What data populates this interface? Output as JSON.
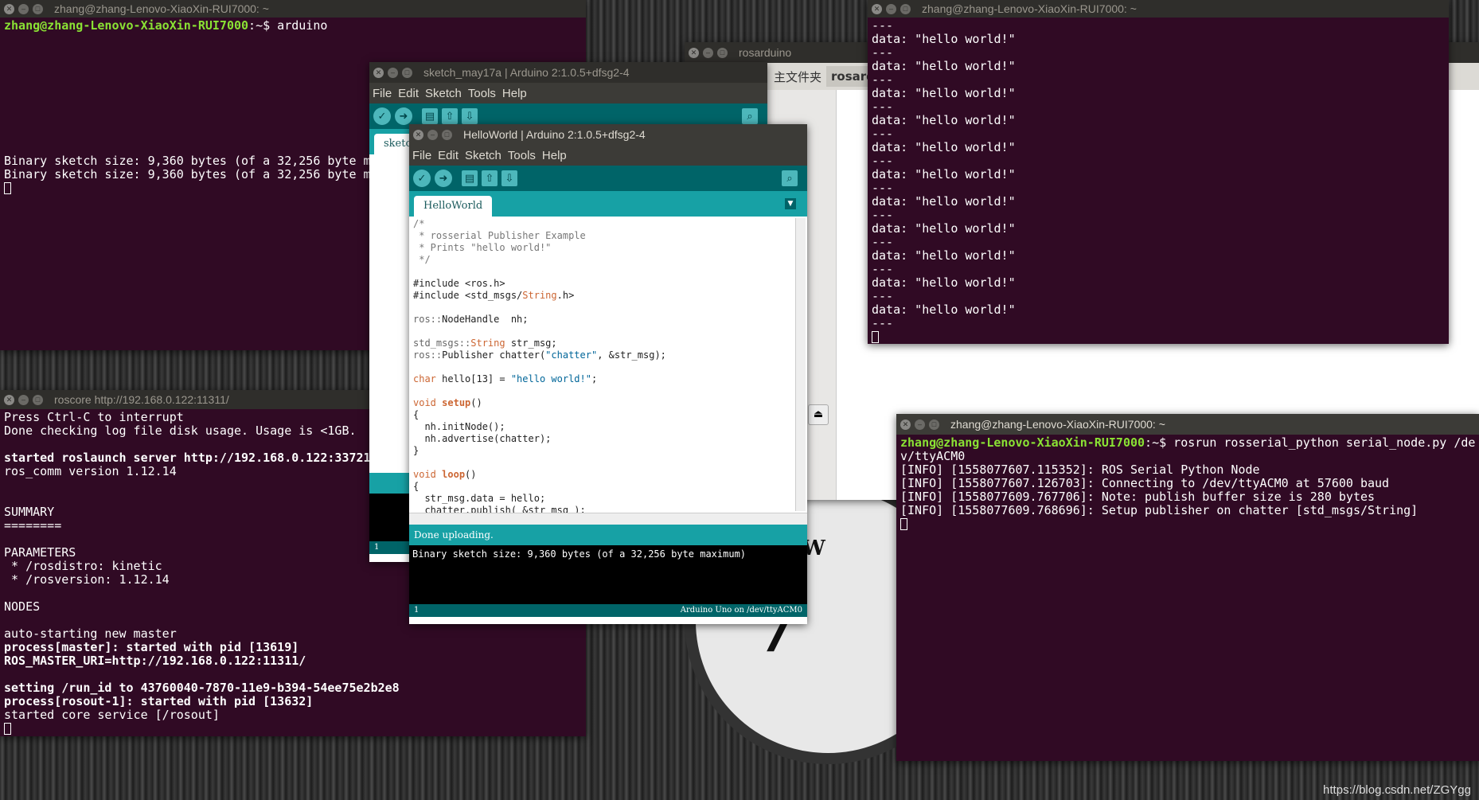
{
  "term_arduino": {
    "title": "zhang@zhang-Lenovo-XiaoXin-RUI7000: ~",
    "prompt_user": "zhang@zhang-Lenovo-XiaoXin-RUI7000",
    "prompt_path": ":~$ ",
    "command": "arduino",
    "line1": "Binary sketch size: 9,360 bytes (of a 32,256 byte m",
    "line2": "Binary sketch size: 9,360 bytes (of a 32,256 byte m"
  },
  "term_roscore": {
    "title": "roscore http://192.168.0.122:11311/",
    "lines": [
      {
        "t": "Press Ctrl-C to interrupt",
        "b": false
      },
      {
        "t": "Done checking log file disk usage. Usage is <1GB.",
        "b": false
      },
      {
        "t": "",
        "b": false
      },
      {
        "t": "started roslaunch server http://192.168.0.122:33721",
        "b": true
      },
      {
        "t": "ros_comm version 1.12.14",
        "b": false
      },
      {
        "t": "",
        "b": false
      },
      {
        "t": "",
        "b": false
      },
      {
        "t": "SUMMARY",
        "b": false
      },
      {
        "t": "========",
        "b": false
      },
      {
        "t": "",
        "b": false
      },
      {
        "t": "PARAMETERS",
        "b": false
      },
      {
        "t": " * /rosdistro: kinetic",
        "b": false
      },
      {
        "t": " * /rosversion: 1.12.14",
        "b": false
      },
      {
        "t": "",
        "b": false
      },
      {
        "t": "NODES",
        "b": false
      },
      {
        "t": "",
        "b": false
      },
      {
        "t": "auto-starting new master",
        "b": false
      },
      {
        "t": "process[master]: started with pid [13619]",
        "b": true
      },
      {
        "t": "ROS_MASTER_URI=http://192.168.0.122:11311/",
        "b": true
      },
      {
        "t": "",
        "b": false
      },
      {
        "t": "setting /run_id to 43760040-7870-11e9-b394-54ee75e2b2e8",
        "b": true
      },
      {
        "t": "process[rosout-1]: started with pid [13632]",
        "b": true
      },
      {
        "t": "started core service [/rosout]",
        "b": false
      }
    ]
  },
  "rosarduino_folder": {
    "title": "rosarduino",
    "crumb1": "主文件夹",
    "crumb2": "rosard"
  },
  "sketch_may17a": {
    "title": "sketch_may17a | Arduino 2:1.0.5+dfsg2-4",
    "menu": [
      "File",
      "Edit",
      "Sketch",
      "Tools",
      "Help"
    ],
    "tab": "sketch",
    "line_num": "1"
  },
  "helloworld": {
    "title": "HelloWorld | Arduino 2:1.0.5+dfsg2-4",
    "menu": [
      "File",
      "Edit",
      "Sketch",
      "Tools",
      "Help"
    ],
    "tab": "HelloWorld",
    "status": "Done uploading.",
    "console": "Binary sketch size: 9,360 bytes (of a 32,256 byte maximum)",
    "line_num": "1",
    "board": "Arduino Uno on /dev/ttyACM0"
  },
  "term_echo": {
    "title": "zhang@zhang-Lenovo-XiaoXin-RUI7000: ~",
    "sep": "---",
    "data_line": "data: \"hello world!\"",
    "count": 11
  },
  "term_serial": {
    "title": "zhang@zhang-Lenovo-XiaoXin-RUI7000: ~",
    "prompt_user": "zhang@zhang-Lenovo-XiaoXin-RUI7000",
    "prompt_path": ":~$ ",
    "command": "rosrun rosserial_python serial_node.py /de",
    "command_cont": "v/ttyACM0",
    "lines": [
      "[INFO] [1558077607.115352]: ROS Serial Python Node",
      "[INFO] [1558077607.126703]: Connecting to /dev/ttyACM0 at 57600 baud",
      "[INFO] [1558077609.767706]: Note: publish buffer size is 280 bytes",
      "[INFO] [1558077609.768696]: Setup publisher on chatter [std_msgs/String]"
    ]
  },
  "watermark": "https://blog.csdn.net/ZGYgg"
}
